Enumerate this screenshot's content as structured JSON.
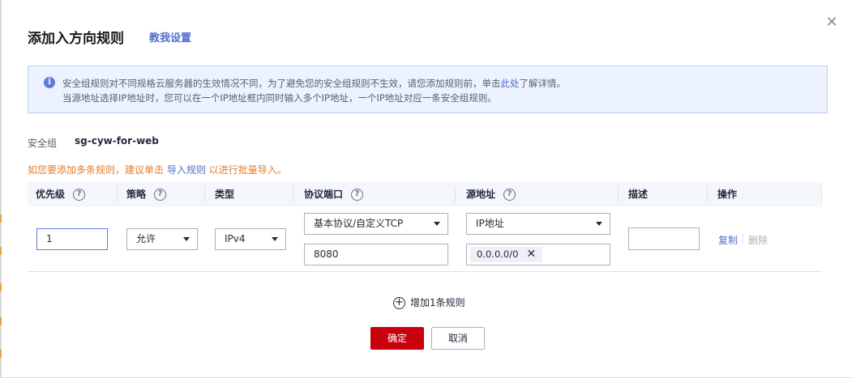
{
  "dialog": {
    "title": "添加入方向规则",
    "help_link": "教我设置",
    "close_icon": "close-icon"
  },
  "notice": {
    "line1_prefix": "安全组规则对不同规格云服务器的生效情况不同，为了避免您的安全组规则不生效，请您添加规则前，单击",
    "line1_link": "此处",
    "line1_suffix": "了解详情。",
    "line2": "当源地址选择IP地址时，您可以在一个IP地址框内同时输入多个IP地址，一个IP地址对应一条安全组规则。"
  },
  "security_group": {
    "label": "安全组",
    "value": "sg-cyw-for-web"
  },
  "batch_tip": {
    "prefix": "如您要添加多条规则，建议单击 ",
    "link": "导入规则",
    "suffix": " 以进行批量导入。"
  },
  "table": {
    "columns": [
      {
        "label": "优先级",
        "help": "?"
      },
      {
        "label": "策略",
        "help": "?"
      },
      {
        "label": "类型",
        "help": ""
      },
      {
        "label": "协议端口",
        "help": "?"
      },
      {
        "label": "源地址",
        "help": "?"
      },
      {
        "label": "描述",
        "help": ""
      },
      {
        "label": "操作",
        "help": ""
      }
    ],
    "rows": [
      {
        "priority": "1",
        "policy": "允许",
        "type": "IPv4",
        "protocol": "基本协议/自定义TCP",
        "port": "8080",
        "source_type": "IP地址",
        "source_ip": "0.0.0.0/0",
        "tag_remove": "✕",
        "description": "",
        "copy": "复制",
        "delete": "删除"
      }
    ]
  },
  "add_rule": {
    "icon": "plus-circle-icon",
    "label": "增加1条规则"
  },
  "buttons": {
    "ok": "确定",
    "cancel": "取消"
  },
  "colors": {
    "primary_button": "#c7000b",
    "link": "#526ecc",
    "warning_text": "#e37d29",
    "notice_bg": "#edf3fe"
  }
}
